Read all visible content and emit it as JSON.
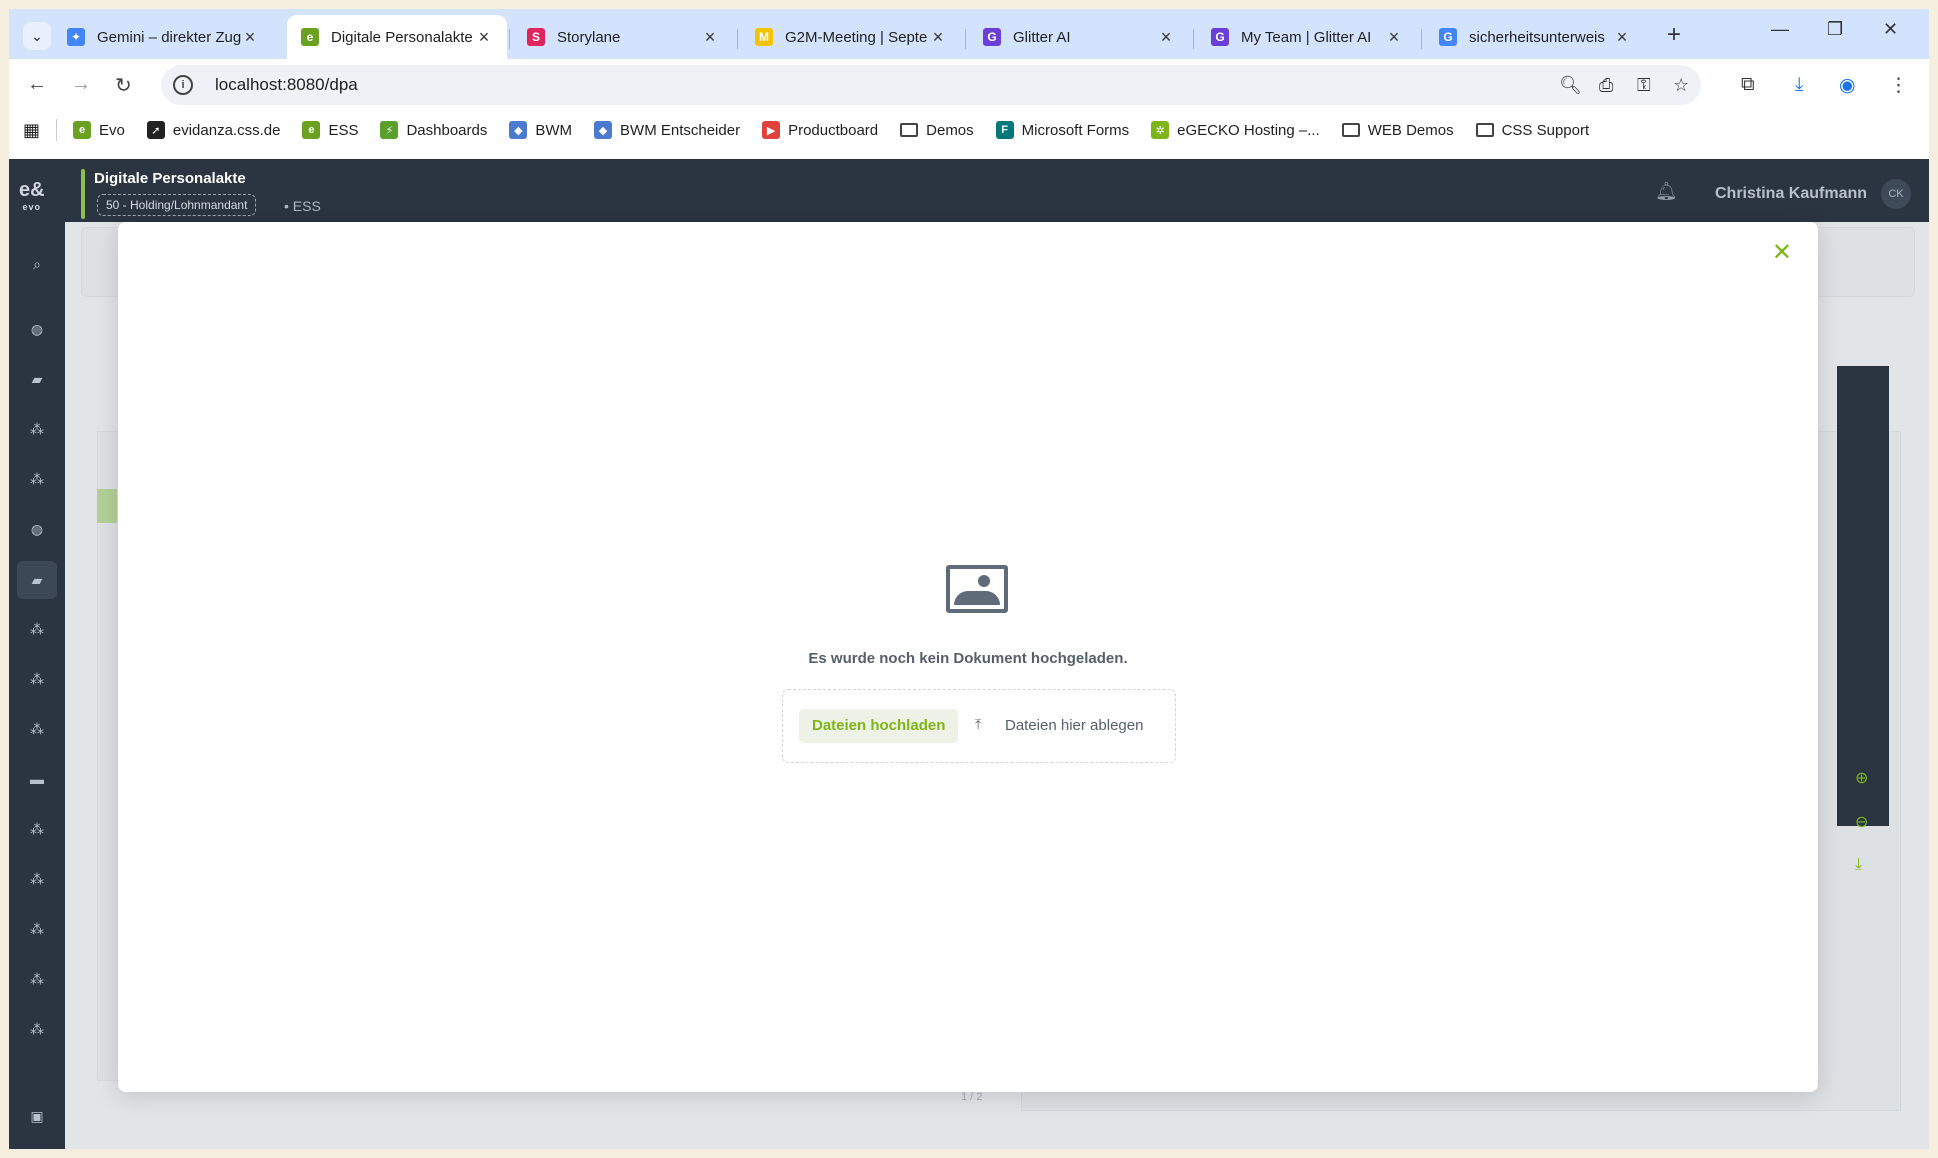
{
  "browser": {
    "tabs": [
      {
        "title": "Gemini – direkter Zug",
        "icon": "gemini-icon",
        "color": "#4285f4",
        "glyph": "✦"
      },
      {
        "title": "Digitale Personalakte",
        "icon": "evo-icon",
        "color": "#6aa121",
        "glyph": "e"
      },
      {
        "title": "Storylane",
        "icon": "storylane-icon",
        "color": "#e0245e",
        "glyph": "S"
      },
      {
        "title": "G2M-Meeting | Septe",
        "icon": "miro-icon",
        "color": "#f5c400",
        "glyph": "M"
      },
      {
        "title": "Glitter AI",
        "icon": "glitter-icon",
        "color": "#6b3fd6",
        "glyph": "G"
      },
      {
        "title": "My Team | Glitter AI",
        "icon": "glitter-icon",
        "color": "#6b3fd6",
        "glyph": "G"
      },
      {
        "title": "sicherheitsunterweis",
        "icon": "google-icon",
        "color": "#4285f4",
        "glyph": "G"
      }
    ],
    "url": "localhost:8080/dpa",
    "bookmarks": [
      {
        "label": "Evo",
        "color": "#6aa121",
        "glyph": "e"
      },
      {
        "label": "evidanza.css.de",
        "color": "#222",
        "glyph": "➚"
      },
      {
        "label": "ESS",
        "color": "#6aa121",
        "glyph": "e"
      },
      {
        "label": "Dashboards",
        "color": "#5aa02c",
        "glyph": "⚡"
      },
      {
        "label": "BWM",
        "color": "#4a7bd0",
        "glyph": "◆"
      },
      {
        "label": "BWM Entscheider",
        "color": "#4a7bd0",
        "glyph": "◆"
      },
      {
        "label": "Productboard",
        "color": "#e0413a",
        "glyph": "▶"
      },
      {
        "label": "Demos",
        "folder": true
      },
      {
        "label": "Microsoft Forms",
        "color": "#03787c",
        "glyph": "F"
      },
      {
        "label": "eGECKO Hosting –...",
        "color": "#7cb518",
        "glyph": "✲"
      },
      {
        "label": "WEB Demos",
        "folder": true
      },
      {
        "label": "CSS Support",
        "folder": true
      }
    ]
  },
  "app": {
    "title": "Digitale Personalakte",
    "mandant": "50 - Holding/Lohnmandant",
    "module": "ESS",
    "user_name": "Christina Kaufmann",
    "user_initials": "CK",
    "logo": "evo"
  },
  "modal": {
    "empty_message": "Es wurde noch kein Dokument hochgeladen.",
    "upload_label": "Dateien hochladen",
    "drop_label": "Dateien hier ablegen"
  },
  "background": {
    "pager": "1 / 2"
  },
  "colors": {
    "accent": "#7cb518",
    "header": "#2b3542"
  }
}
